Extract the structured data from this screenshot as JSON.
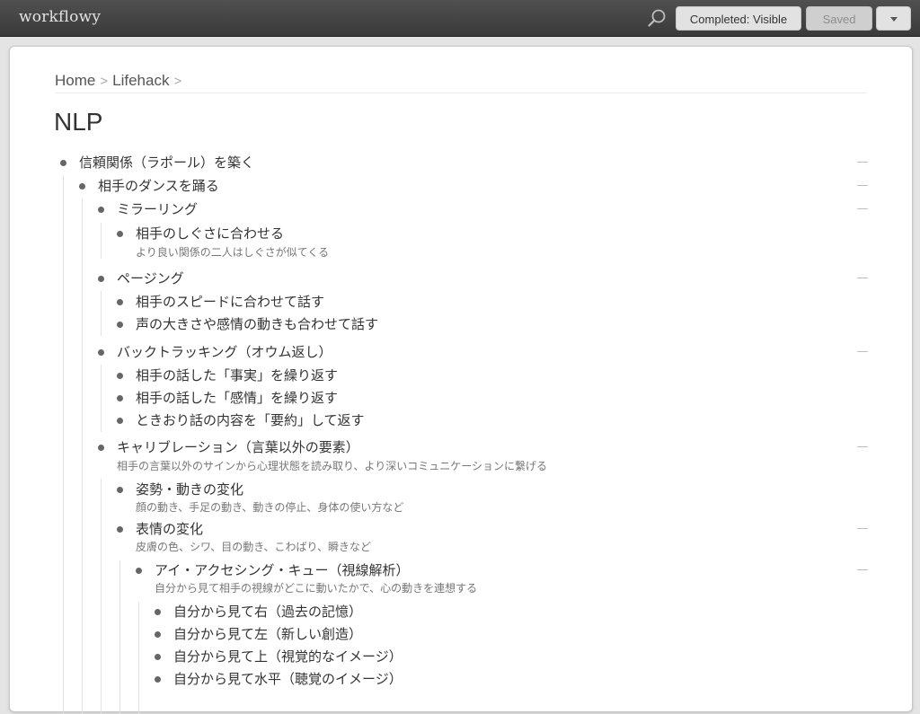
{
  "app": {
    "logo": "workflowy"
  },
  "toolbar": {
    "search_icon": "search-icon",
    "completed_label": "Completed: Visible",
    "saved_label": "Saved",
    "menu_icon": "caret-down-icon"
  },
  "breadcrumb": {
    "home": "Home",
    "parent": "Lifehack",
    "sep1": ">",
    "sep2": ">"
  },
  "page_title": "NLP",
  "collapse_glyph": "—",
  "outline": {
    "items": [
      {
        "text": "信頼関係（ラポール）を築く"
      },
      {
        "text": "相手のダンスを踊る"
      },
      {
        "text": "ミラーリング"
      },
      {
        "text": "相手のしぐさに合わせる",
        "note": "より良い関係の二人はしぐさが似てくる"
      },
      {
        "text": "ページング"
      },
      {
        "text": "相手のスピードに合わせて話す"
      },
      {
        "text": "声の大きさや感情の動きも合わせて話す"
      },
      {
        "text": "バックトラッキング（オウム返し）"
      },
      {
        "text": "相手の話した「事実」を繰り返す"
      },
      {
        "text": "相手の話した「感情」を繰り返す"
      },
      {
        "text": "ときおり話の内容を「要約」して返す"
      },
      {
        "text": "キャリブレーション（言葉以外の要素）",
        "note": "相手の言葉以外のサインから心理状態を読み取り、より深いコミュニケーションに繋げる"
      },
      {
        "text": "姿勢・動きの変化",
        "note": "顔の動き、手足の動き、動きの停止、身体の使い方など"
      },
      {
        "text": "表情の変化",
        "note": "皮膚の色、シワ、目の動き、こわばり、瞬きなど"
      },
      {
        "text": "アイ・アクセシング・キュー（視線解析）",
        "note": "自分から見て相手の視線がどこに動いたかで、心の動きを連想する"
      },
      {
        "text": "自分から見て右（過去の記憶）"
      },
      {
        "text": "自分から見て左（新しい創造）"
      },
      {
        "text": "自分から見て上（視覚的なイメージ）"
      },
      {
        "text": "自分から見て水平（聴覚のイメージ）"
      }
    ]
  }
}
